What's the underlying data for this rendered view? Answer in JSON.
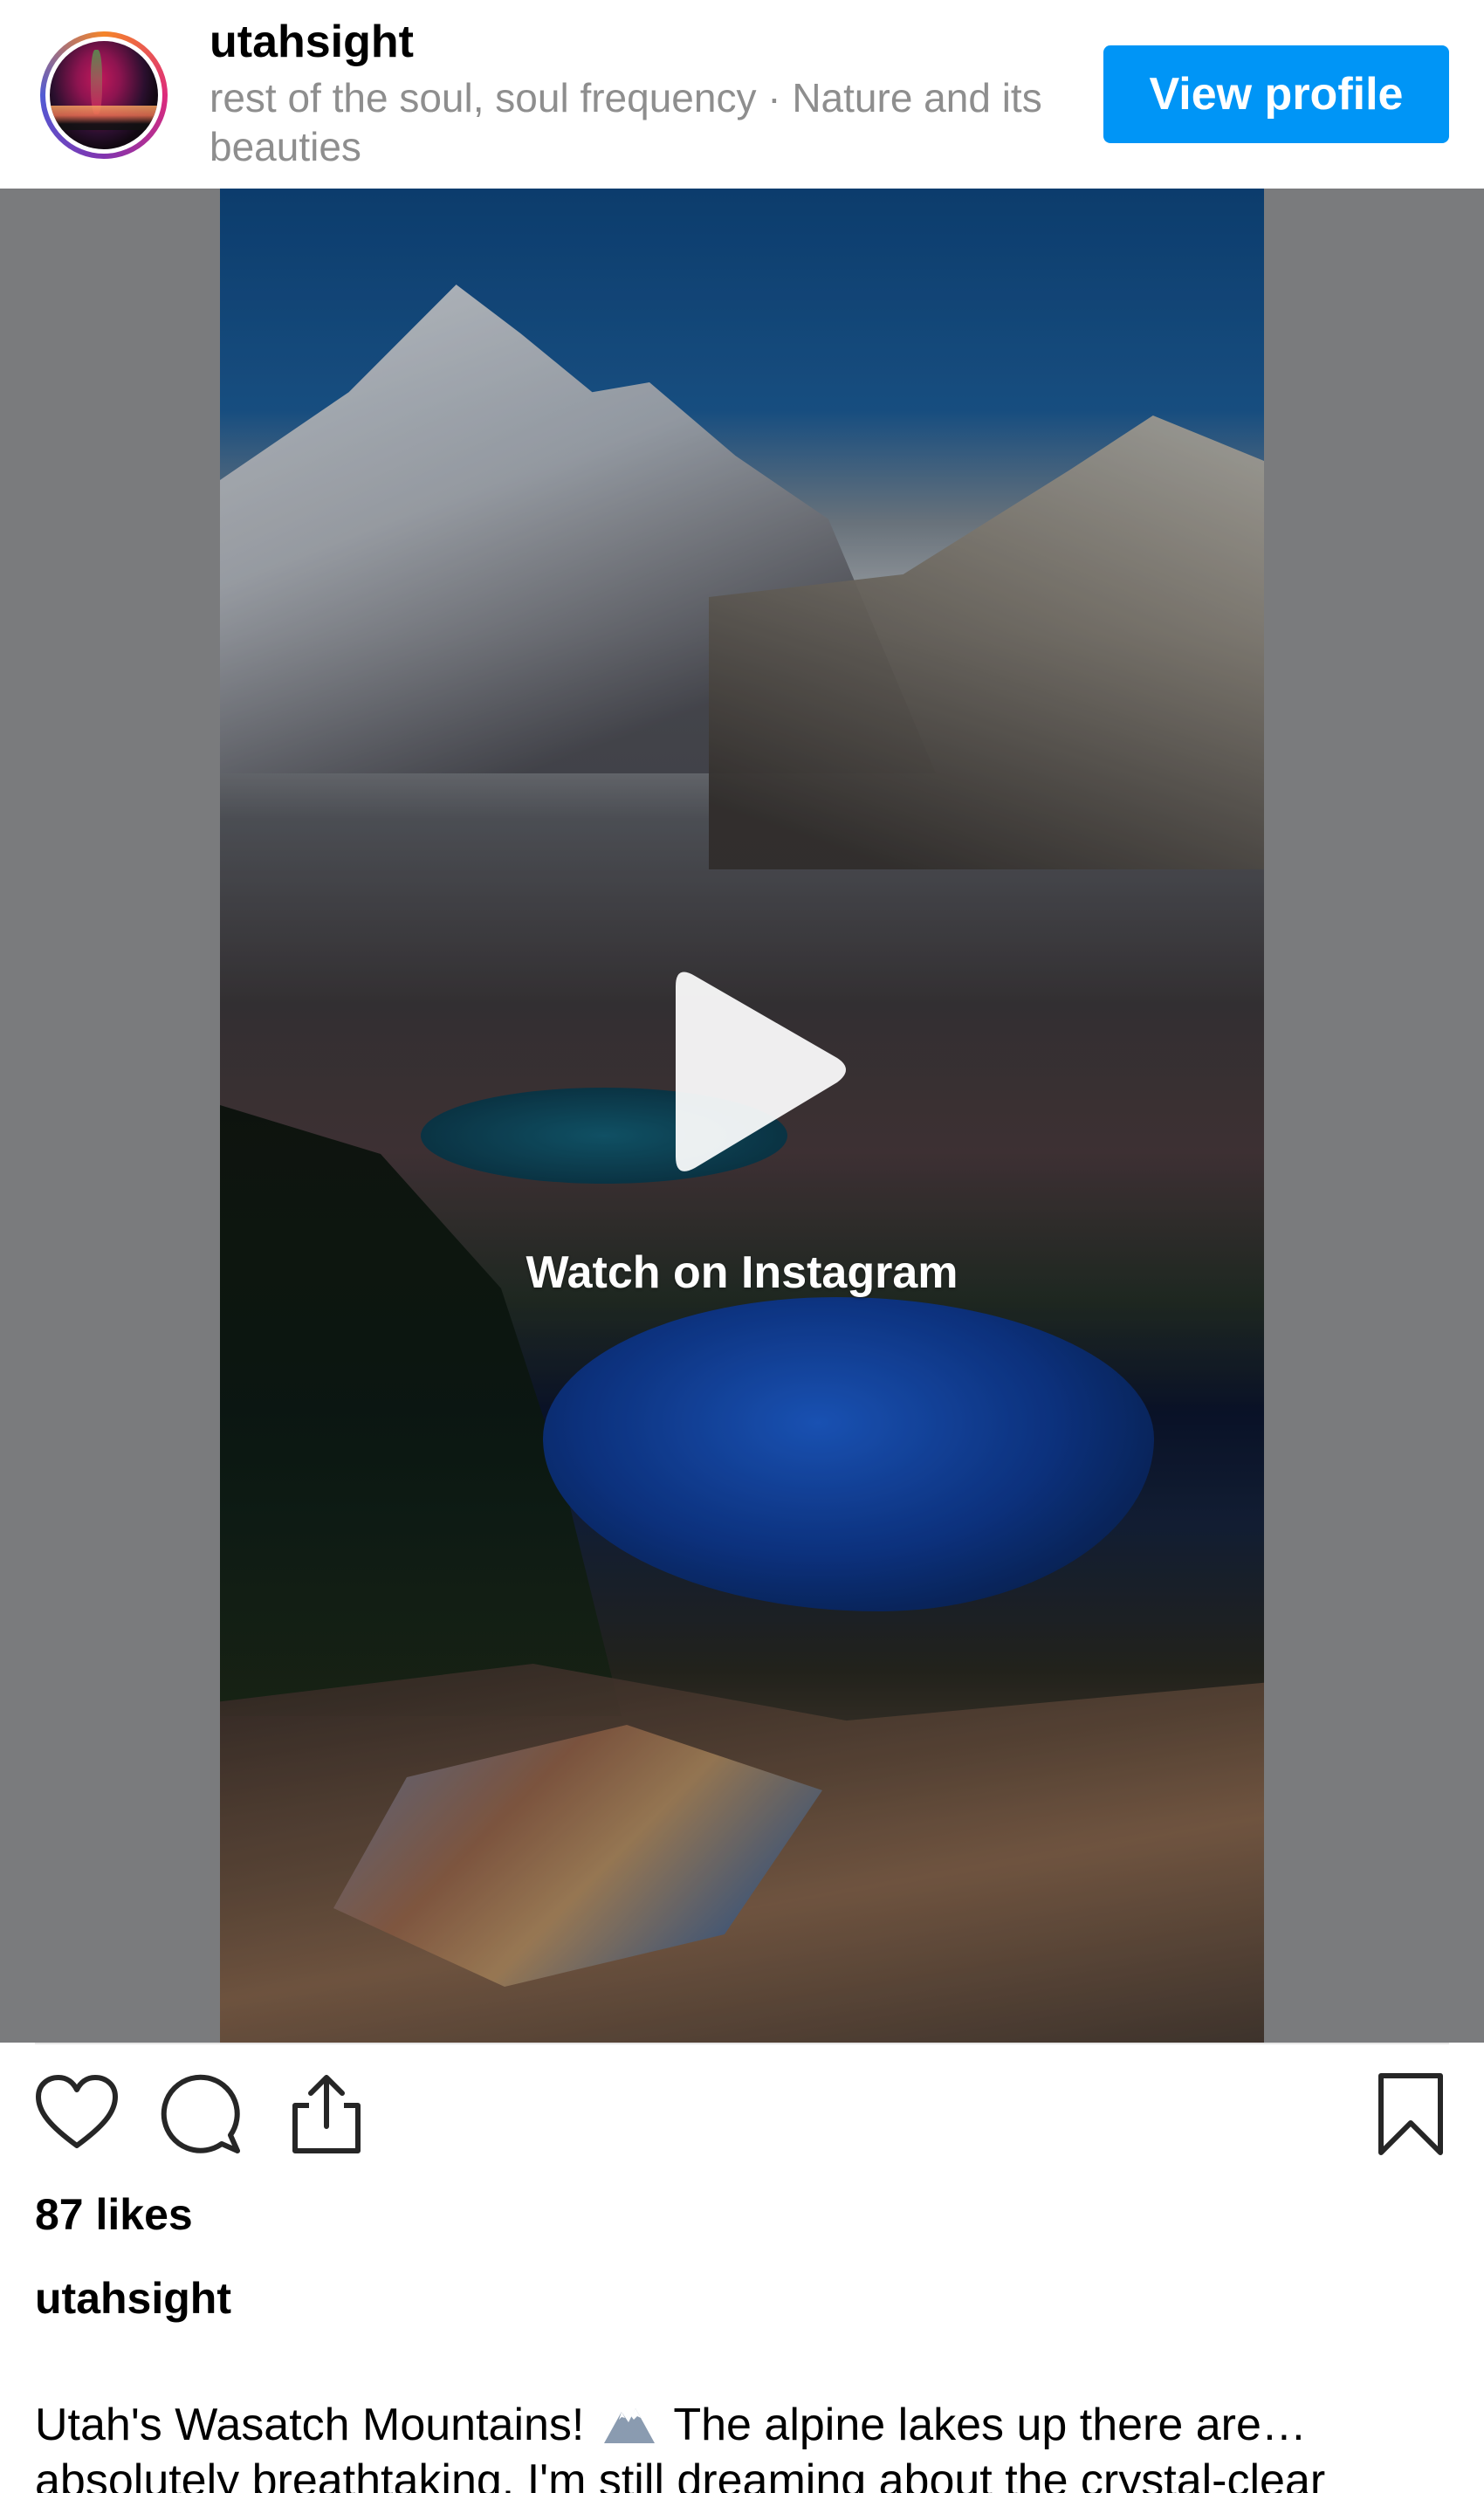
{
  "header": {
    "username": "utahsight",
    "bio": "rest of the soul, soul frequency · Nature and its beauties",
    "view_profile_label": "View profile"
  },
  "media": {
    "watch_label": "Watch on Instagram"
  },
  "actions": {
    "icons": [
      "heart-icon",
      "comment-icon",
      "share-icon",
      "bookmark-icon"
    ]
  },
  "post": {
    "likes": "87 likes",
    "caption_user": "utahsight",
    "caption_start": "Utah's Wasatch Mountains!",
    "caption_rest": "The alpine lakes up there are… absolutely breathtaking. I'm still dreaming about the crystal-clear"
  },
  "colors": {
    "accent": "#0095f6",
    "secondary_text": "#8e8e8e",
    "media_bg": "#7a7b7d"
  }
}
